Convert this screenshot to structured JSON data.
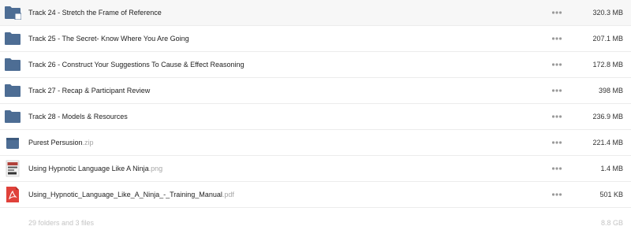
{
  "colors": {
    "folder": "#4d6d94",
    "pdf": "#e0413a",
    "more": "#9a9a9a",
    "muted": "#c4c4c4"
  },
  "items": [
    {
      "name": "Track 24 - Stretch the Frame of Reference",
      "ext": "",
      "size": "320.3 MB",
      "icon": "folder-icon"
    },
    {
      "name": "Track 25 - The Secret- Know Where You Are Going",
      "ext": "",
      "size": "207.1 MB",
      "icon": "folder-icon"
    },
    {
      "name": "Track 26 - Construct Your Suggestions To Cause & Effect Reasoning",
      "ext": "",
      "size": "172.8 MB",
      "icon": "folder-icon"
    },
    {
      "name": "Track 27 - Recap & Participant Review",
      "ext": "",
      "size": "398 MB",
      "icon": "folder-icon"
    },
    {
      "name": "Track 28 - Models & Resources",
      "ext": "",
      "size": "236.9 MB",
      "icon": "folder-icon"
    },
    {
      "name": "Purest Persusion",
      "ext": ".zip",
      "size": "221.4 MB",
      "icon": "archive-icon"
    },
    {
      "name": "Using Hypnotic Language Like A Ninja",
      "ext": ".png",
      "size": "1.4 MB",
      "icon": "image-thumbnail-icon"
    },
    {
      "name": "Using_Hypnotic_Language_Like_A_Ninja_-_Training_Manual",
      "ext": ".pdf",
      "size": "501 KB",
      "icon": "pdf-icon"
    }
  ],
  "summary": {
    "count": "29 folders and 3 files",
    "total": "8.8 GB"
  }
}
